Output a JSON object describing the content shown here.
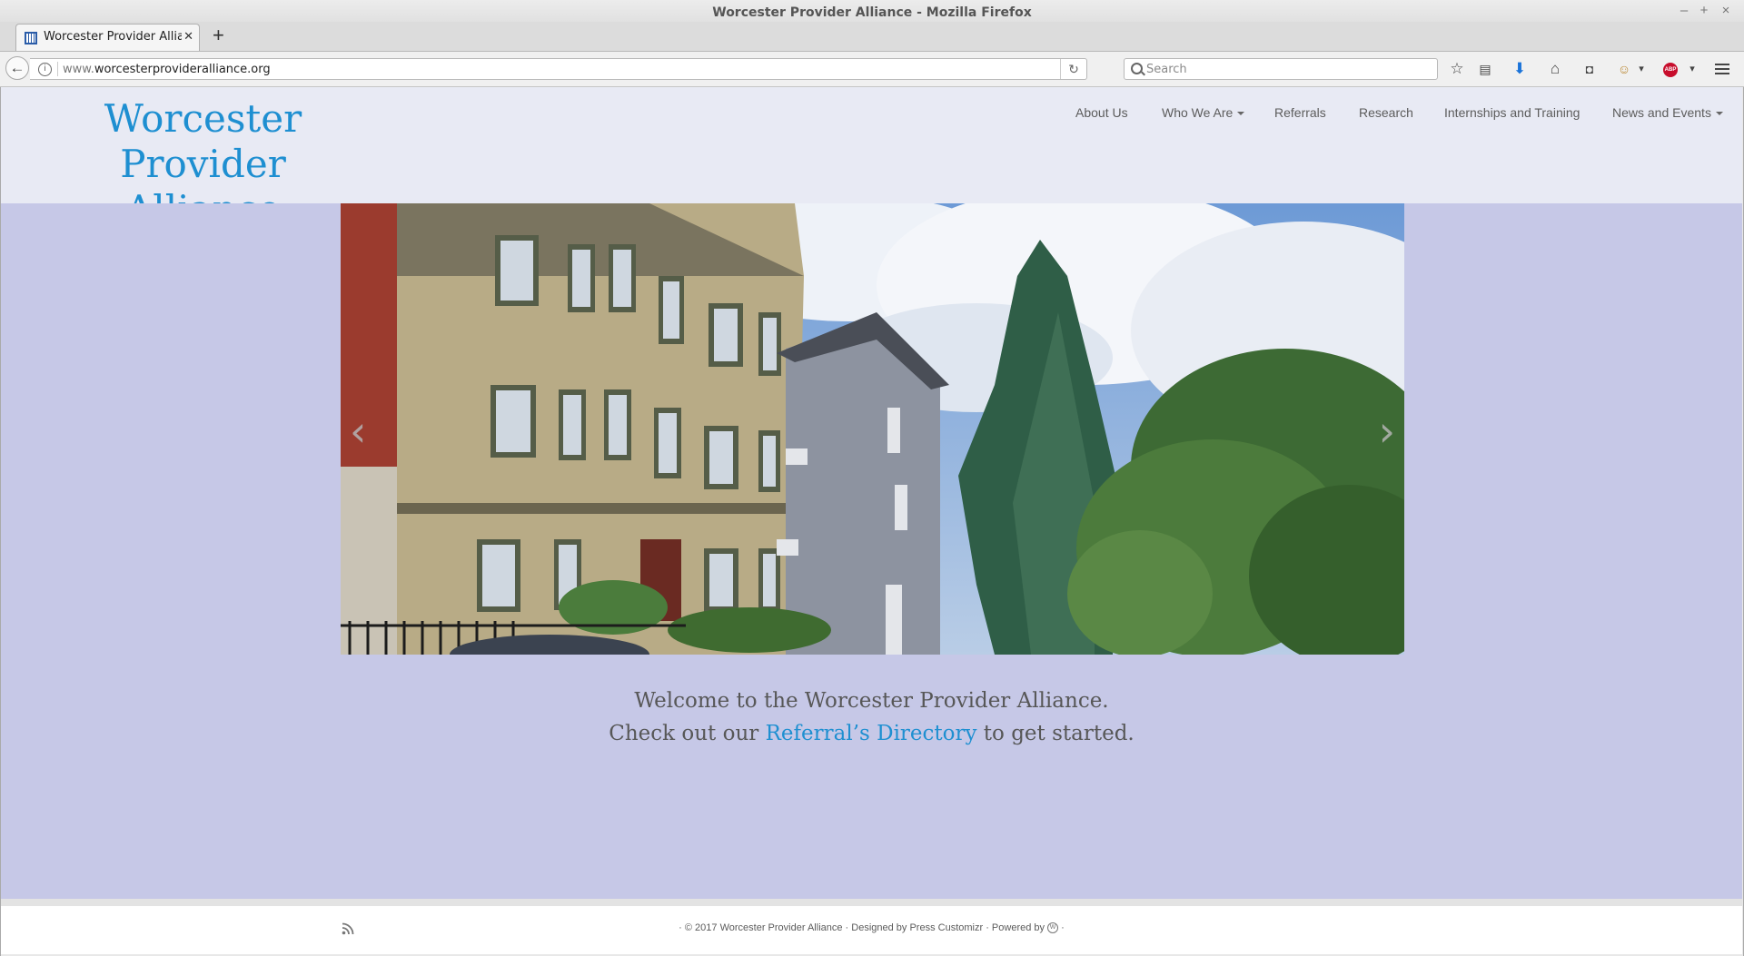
{
  "window": {
    "title": "Worcester Provider Alliance - Mozilla Firefox"
  },
  "tab": {
    "title": "Worcester Provider Alliance"
  },
  "urlbar": {
    "prefix": "www.",
    "domain": "worcesterprovideralliance.org"
  },
  "searchbar": {
    "placeholder": "Search"
  },
  "site": {
    "logo_line1": "Worcester Provider",
    "logo_line2": "Alliance",
    "menu": [
      {
        "label": "About Us",
        "dropdown": false
      },
      {
        "label": "Who We Are",
        "dropdown": true
      },
      {
        "label": "Referrals",
        "dropdown": false
      },
      {
        "label": "Research",
        "dropdown": false
      },
      {
        "label": "Internships and Training",
        "dropdown": false
      },
      {
        "label": "News and Events",
        "dropdown": true
      }
    ]
  },
  "hero": {
    "prev_glyph": "‹",
    "next_glyph": "›"
  },
  "welcome": {
    "line1": "Welcome to the Worcester Provider Alliance.",
    "line2_before": "Check out our ",
    "link": "Referral’s Directory",
    "line2_after": " to get started."
  },
  "footer": {
    "before_designer": "· © 2017 Worcester Provider Alliance · Designed by ",
    "designer": "Press Customizr",
    "powered": " · Powered by ",
    "after": " ·"
  },
  "colors": {
    "accent": "#1e8fd1",
    "main_bg": "#c6c8e7",
    "header_bg": "#e8eaf4"
  }
}
